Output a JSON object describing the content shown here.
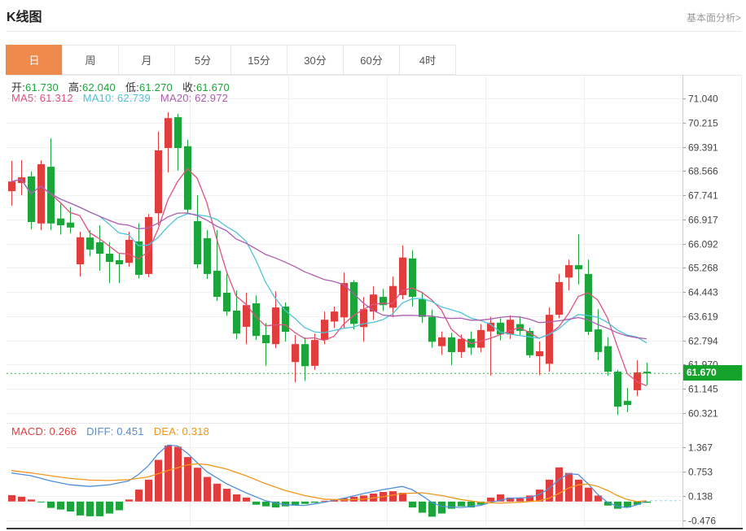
{
  "header": {
    "title": "K线图",
    "analysis_link": "基本面分析>"
  },
  "tabs": [
    "日",
    "周",
    "月",
    "5分",
    "15分",
    "30分",
    "60分",
    "4时"
  ],
  "selected_tab": "日",
  "main_legend": {
    "open_label": "开:",
    "open_value": "61.730",
    "high_label": "高:",
    "high_value": "62.040",
    "low_label": "低:",
    "low_value": "61.270",
    "close_label": "收:",
    "close_value": "61.670"
  },
  "ma_legend": {
    "ma5_label": "MA5:",
    "ma5_value": "61.312",
    "ma10_label": "MA10:",
    "ma10_value": "62.739",
    "ma20_label": "MA20:",
    "ma20_value": "62.972"
  },
  "macd_legend": {
    "macd_label": "MACD:",
    "macd_value": "0.266",
    "diff_label": "DIFF:",
    "diff_value": "0.451",
    "dea_label": "DEA:",
    "dea_value": "0.318"
  },
  "price_tag": {
    "value": "61.670"
  },
  "colors": {
    "up": "#e23d3d",
    "down": "#1ba53b",
    "ma5": "#e0517e",
    "ma10": "#4cc3da",
    "ma20": "#ad5cb2",
    "diff": "#4f8fdc",
    "dea": "#f2971b",
    "tag_bg": "#16a32c",
    "dotted_line": "#33b54a",
    "accent_tab": "#ee8a4c"
  },
  "chart_data": [
    {
      "type": "candlestick",
      "panel": "main",
      "title": "K线图 日",
      "y_axis_labels": [
        "71.040",
        "70.215",
        "69.391",
        "68.566",
        "67.741",
        "66.917",
        "66.092",
        "65.268",
        "64.443",
        "63.619",
        "62.794",
        "61.970",
        "61.145",
        "60.321"
      ],
      "current_price": 61.67,
      "ma_periods": [
        5,
        10,
        20
      ],
      "candle_format": [
        "open",
        "high",
        "low",
        "close"
      ],
      "candles": [
        [
          67.88,
          68.91,
          67.38,
          68.21
        ],
        [
          68.16,
          68.94,
          67.74,
          68.35
        ],
        [
          68.38,
          68.55,
          66.58,
          66.83
        ],
        [
          66.78,
          68.93,
          66.55,
          68.8
        ],
        [
          68.71,
          69.68,
          66.55,
          66.78
        ],
        [
          66.95,
          67.45,
          66.4,
          66.72
        ],
        [
          66.81,
          67.33,
          66.44,
          66.64
        ],
        [
          65.39,
          66.5,
          64.97,
          66.31
        ],
        [
          66.3,
          66.55,
          65.66,
          65.89
        ],
        [
          66.14,
          66.72,
          65.17,
          65.75
        ],
        [
          65.75,
          66.14,
          64.75,
          65.47
        ],
        [
          65.53,
          65.75,
          64.75,
          65.39
        ],
        [
          65.44,
          66.5,
          65.3,
          66.22
        ],
        [
          66.17,
          66.78,
          64.9,
          65.03
        ],
        [
          65.06,
          67.1,
          64.95,
          67.0
        ],
        [
          67.13,
          69.91,
          66.72,
          69.27
        ],
        [
          69.35,
          70.57,
          68.52,
          70.37
        ],
        [
          70.4,
          70.51,
          68.58,
          69.35
        ],
        [
          69.41,
          69.63,
          67.1,
          67.25
        ],
        [
          66.86,
          67.74,
          65.25,
          65.39
        ],
        [
          66.28,
          66.55,
          64.89,
          65.06
        ],
        [
          65.17,
          66.55,
          64.14,
          64.28
        ],
        [
          64.42,
          65.06,
          63.64,
          63.78
        ],
        [
          63.81,
          64.5,
          62.84,
          63.03
        ],
        [
          63.26,
          64.42,
          62.67,
          64.0
        ],
        [
          64.06,
          64.33,
          62.81,
          62.95
        ],
        [
          62.98,
          63.39,
          61.93,
          62.7
        ],
        [
          62.67,
          64.47,
          62.53,
          63.92
        ],
        [
          63.95,
          64.09,
          62.76,
          63.09
        ],
        [
          62.06,
          62.98,
          61.37,
          62.67
        ],
        [
          62.67,
          62.9,
          61.42,
          61.92
        ],
        [
          61.93,
          63.03,
          61.79,
          62.81
        ],
        [
          62.81,
          63.78,
          62.67,
          63.5
        ],
        [
          63.44,
          63.95,
          63.22,
          63.78
        ],
        [
          63.58,
          65.11,
          63.22,
          64.75
        ],
        [
          64.78,
          64.85,
          63.17,
          63.36
        ],
        [
          63.25,
          64.28,
          62.75,
          63.86
        ],
        [
          63.78,
          64.64,
          63.5,
          64.36
        ],
        [
          64.28,
          64.55,
          63.8,
          64.0
        ],
        [
          63.91,
          64.97,
          63.59,
          64.65
        ],
        [
          64.34,
          66.03,
          64.2,
          65.62
        ],
        [
          65.59,
          65.87,
          63.95,
          64.28
        ],
        [
          64.2,
          64.45,
          63.4,
          63.6
        ],
        [
          63.6,
          63.85,
          62.55,
          62.75
        ],
        [
          62.6,
          63.1,
          62.3,
          62.9
        ],
        [
          62.9,
          63.05,
          61.95,
          62.4
        ],
        [
          62.4,
          63.0,
          62.2,
          62.85
        ],
        [
          62.85,
          63.1,
          62.3,
          62.55
        ],
        [
          62.55,
          63.35,
          62.4,
          63.15
        ],
        [
          63.1,
          63.6,
          61.6,
          63.4
        ],
        [
          63.4,
          63.55,
          62.8,
          63.0
        ],
        [
          63.0,
          63.65,
          62.85,
          63.5
        ],
        [
          63.35,
          63.6,
          62.95,
          63.12
        ],
        [
          63.12,
          63.23,
          62.2,
          62.29
        ],
        [
          62.26,
          62.76,
          61.61,
          62.43
        ],
        [
          62.0,
          63.92,
          61.73,
          63.67
        ],
        [
          63.67,
          65.06,
          63.55,
          64.78
        ],
        [
          64.94,
          65.55,
          64.5,
          65.36
        ],
        [
          65.36,
          66.41,
          64.7,
          65.22
        ],
        [
          65.06,
          65.55,
          62.98,
          63.09
        ],
        [
          63.17,
          63.86,
          62.12,
          62.4
        ],
        [
          62.6,
          62.9,
          61.59,
          61.73
        ],
        [
          61.73,
          61.79,
          60.26,
          60.54
        ],
        [
          60.74,
          61.18,
          60.35,
          60.6
        ],
        [
          61.1,
          62.12,
          60.9,
          61.71
        ],
        [
          61.73,
          62.04,
          61.27,
          61.67
        ]
      ]
    },
    {
      "type": "bar",
      "panel": "macd",
      "title": "MACD",
      "y_axis_labels": [
        "1.367",
        "0.753",
        "0.138",
        "-0.476"
      ],
      "histogram": [
        0.16,
        0.12,
        0.05,
        -0.02,
        -0.16,
        -0.2,
        -0.25,
        -0.35,
        -0.37,
        -0.37,
        -0.3,
        -0.22,
        0.05,
        0.3,
        0.55,
        1.05,
        1.41,
        1.38,
        1.12,
        0.85,
        0.62,
        0.45,
        0.32,
        0.18,
        0.1,
        -0.08,
        -0.12,
        -0.15,
        -0.12,
        -0.1,
        -0.06,
        -0.03,
        0.02,
        0.04,
        0.08,
        0.12,
        0.15,
        0.2,
        0.24,
        0.26,
        0.22,
        -0.15,
        -0.28,
        -0.38,
        -0.3,
        -0.18,
        -0.12,
        -0.15,
        -0.08,
        0.1,
        0.18,
        0.1,
        0.08,
        0.15,
        0.3,
        0.55,
        0.86,
        0.72,
        0.55,
        0.35,
        0.15,
        -0.1,
        -0.18,
        -0.15,
        -0.08,
        -0.03
      ],
      "diff_line": {
        "points": [
          [
            1,
            0.72
          ],
          [
            3,
            0.65
          ],
          [
            5,
            0.52
          ],
          [
            7,
            0.42
          ],
          [
            9,
            0.38
          ],
          [
            11,
            0.42
          ],
          [
            13,
            0.52
          ],
          [
            14,
            0.68
          ],
          [
            15,
            0.9
          ],
          [
            16,
            1.2
          ],
          [
            17,
            1.42
          ],
          [
            18,
            1.4
          ],
          [
            19,
            1.22
          ],
          [
            20,
            0.98
          ],
          [
            21,
            0.75
          ],
          [
            23,
            0.45
          ],
          [
            25,
            0.22
          ],
          [
            27,
            0.02
          ],
          [
            29,
            -0.08
          ],
          [
            31,
            -0.1
          ],
          [
            33,
            -0.02
          ],
          [
            35,
            0.08
          ],
          [
            37,
            0.2
          ],
          [
            39,
            0.3
          ],
          [
            41,
            0.38
          ],
          [
            42,
            0.3
          ],
          [
            43,
            0.15
          ],
          [
            44,
            -0.02
          ],
          [
            45,
            -0.12
          ],
          [
            47,
            -0.15
          ],
          [
            49,
            -0.1
          ],
          [
            50,
            -0.02
          ],
          [
            52,
            0.08
          ],
          [
            54,
            0.1
          ],
          [
            55,
            0.18
          ],
          [
            56,
            0.32
          ],
          [
            57,
            0.55
          ],
          [
            58,
            0.7
          ],
          [
            59,
            0.68
          ],
          [
            60,
            0.45
          ],
          [
            61,
            0.18
          ],
          [
            62,
            -0.02
          ],
          [
            63,
            -0.12
          ],
          [
            64,
            -0.15
          ],
          [
            65,
            -0.08
          ],
          [
            66,
            0.02
          ]
        ]
      },
      "dea_line": {
        "points": [
          [
            1,
            0.78
          ],
          [
            3,
            0.72
          ],
          [
            5,
            0.65
          ],
          [
            7,
            0.58
          ],
          [
            9,
            0.54
          ],
          [
            11,
            0.53
          ],
          [
            13,
            0.55
          ],
          [
            15,
            0.62
          ],
          [
            17,
            0.78
          ],
          [
            19,
            0.92
          ],
          [
            20,
            0.95
          ],
          [
            21,
            0.93
          ],
          [
            23,
            0.82
          ],
          [
            25,
            0.65
          ],
          [
            27,
            0.45
          ],
          [
            29,
            0.28
          ],
          [
            31,
            0.15
          ],
          [
            33,
            0.06
          ],
          [
            35,
            0.04
          ],
          [
            37,
            0.06
          ],
          [
            39,
            0.12
          ],
          [
            41,
            0.2
          ],
          [
            43,
            0.22
          ],
          [
            45,
            0.15
          ],
          [
            47,
            0.05
          ],
          [
            49,
            -0.02
          ],
          [
            51,
            -0.04
          ],
          [
            53,
            -0.02
          ],
          [
            55,
            0.02
          ],
          [
            56,
            0.08
          ],
          [
            57,
            0.2
          ],
          [
            58,
            0.34
          ],
          [
            59,
            0.42
          ],
          [
            60,
            0.44
          ],
          [
            61,
            0.38
          ],
          [
            62,
            0.28
          ],
          [
            63,
            0.15
          ],
          [
            64,
            0.05
          ],
          [
            65,
            0.0
          ],
          [
            66,
            0.02
          ]
        ]
      }
    }
  ]
}
